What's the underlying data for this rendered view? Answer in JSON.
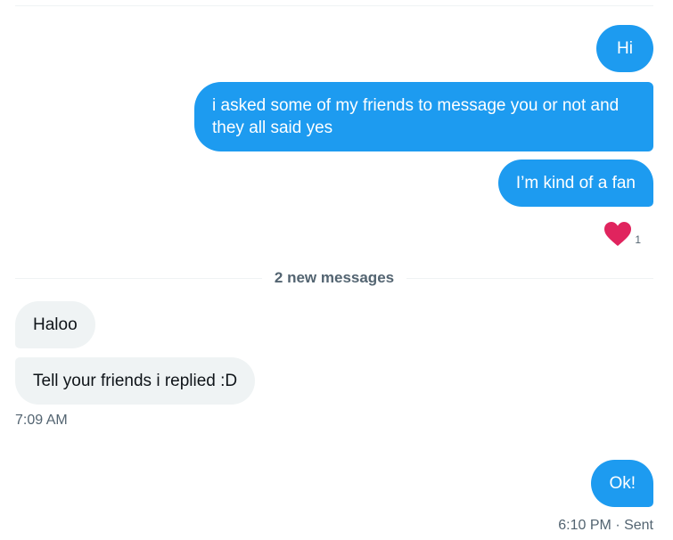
{
  "messages": {
    "m1": "Hi",
    "m2": "i asked some of my friends to message you or not and they all said yes",
    "m3": "I’m kind of a fan",
    "m4": "Haloo",
    "m5": "Tell your friends i replied :D",
    "m6": "Ok!"
  },
  "reaction": {
    "icon": "heart-icon",
    "color": "#e0245e",
    "count": "1"
  },
  "divider_label": "2 new messages",
  "timestamps": {
    "received": "7:09 AM",
    "sent": "6:10 PM · Sent"
  },
  "colors": {
    "outgoing_bubble": "#1d9bf0",
    "incoming_bubble": "#eff3f4",
    "meta_text": "#536471"
  }
}
